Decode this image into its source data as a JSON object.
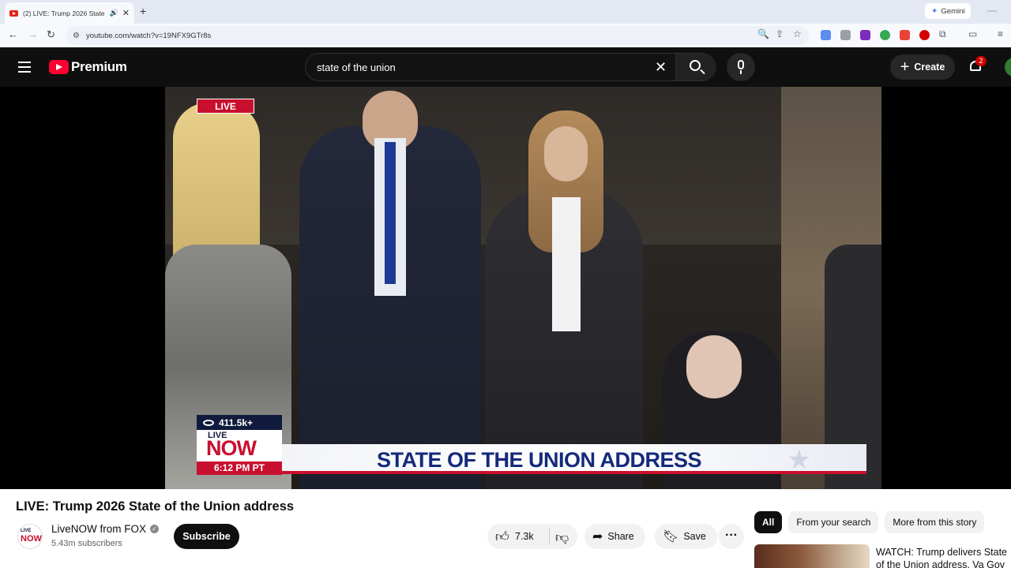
{
  "browser": {
    "tab_title": "(2) LIVE: Trump 2026 State",
    "new_tab": "+",
    "close_tab": "✕",
    "gemini_label": "Gemini",
    "url": "youtube.com/watch?v=19NFX9GTr8s"
  },
  "youtube": {
    "logo_text": "Premium",
    "search_query": "state of the union",
    "create_label": "Create",
    "notification_count": "2"
  },
  "video": {
    "live_badge": "LIVE",
    "views": "411.5k+",
    "network_live": "LIVE",
    "network_now": "NOW",
    "time": "6:12 PM PT",
    "lower_third": "STATE OF THE UNION ADDRESS"
  },
  "watch": {
    "title": "LIVE: Trump 2026 State of the Union address",
    "channel_name": "LiveNOW from FOX",
    "subscribers": "5.43m subscribers",
    "subscribe_label": "Subscribe",
    "likes": "7.3k",
    "share_label": "Share",
    "save_label": "Save"
  },
  "sidebar": {
    "chips": [
      "All",
      "From your search",
      "More from this story"
    ],
    "rec_title": "WATCH: Trump delivers State of the Union address, Va Gov"
  }
}
